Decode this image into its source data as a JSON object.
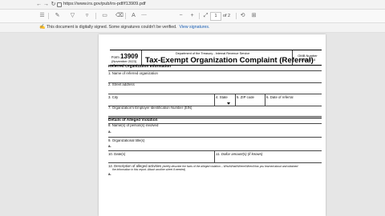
{
  "browser": {
    "url": "https://www.irs.gov/pub/irs-pdf/f13909.pdf",
    "nav": {
      "back": "←",
      "forward": "→",
      "reload": "↻",
      "home": "⌂"
    }
  },
  "pdf_toolbar": {
    "contents_icon": "list-icon",
    "page_current": "1",
    "page_of": "of 2"
  },
  "signature_bar": {
    "message": "This document is digitally signed. Some signatures couldn't be verified.",
    "link": "View signatures."
  },
  "form": {
    "form_label": "Form",
    "form_number": "13909",
    "revision": "(November 2023)",
    "department": "Department of the Treasury - Internal Revenue Service",
    "title": "Tax-Exempt Organization Complaint (Referral)",
    "omb_label": "OMB Number",
    "omb_number": "1545-2214",
    "section1": "Referred Organization Information",
    "f1": "1. Name of referred organization",
    "f2": "2. Street address",
    "f3": "3. City",
    "f4": "4. State",
    "f5": "5. ZIP code",
    "f6": "6. Date of referral",
    "f7": "7. Organization's Employer Identification Number (EIN)",
    "section2": "Details of Alleged Violation",
    "f8": "8. Name(s) of person(s) involved",
    "f8a": "a.",
    "f9": "9. Organizational title(s)",
    "f9a": "a.",
    "f10": "10. Date(s)",
    "f11": "11. Dollar amount(s) (if known)",
    "f12": "12. Description of alleged activities",
    "f12_note": "(briefly describe the facts of the alleged violation – Who/What/Where/When/How you learned about and obtained",
    "f12_note2": "the information in this report. Attach another sheet if needed)",
    "f12a": "a."
  }
}
